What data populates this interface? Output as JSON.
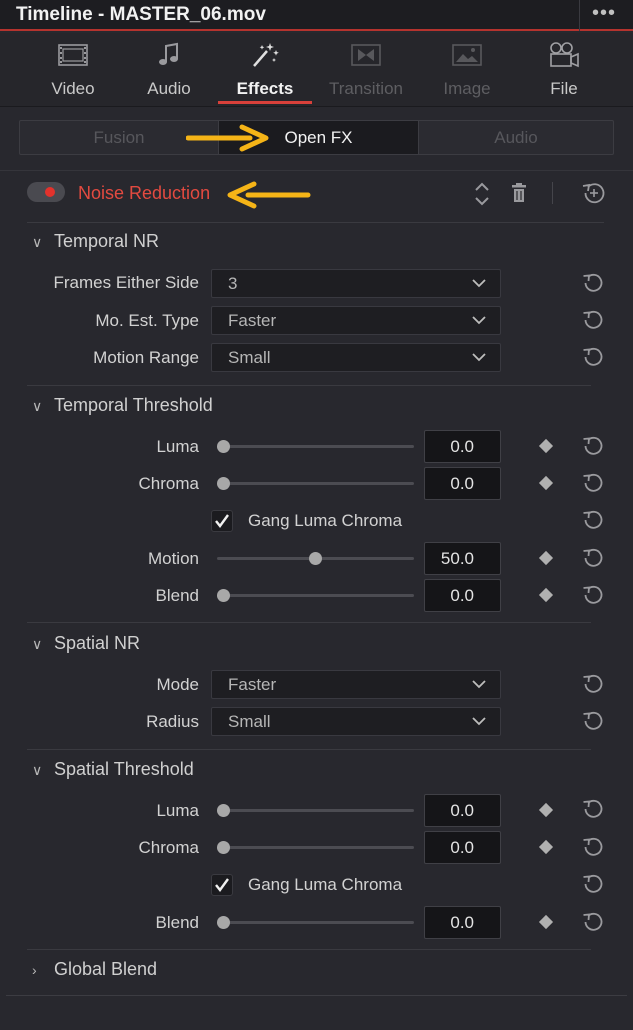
{
  "window": {
    "title": "Timeline - MASTER_06.mov",
    "more_label": "•••"
  },
  "tabs": [
    {
      "label": "Video",
      "icon": "film-strip-icon",
      "state": "normal"
    },
    {
      "label": "Audio",
      "icon": "music-note-icon",
      "state": "normal"
    },
    {
      "label": "Effects",
      "icon": "magic-wand-icon",
      "state": "active"
    },
    {
      "label": "Transition",
      "icon": "transition-icon",
      "state": "disabled"
    },
    {
      "label": "Image",
      "icon": "image-icon",
      "state": "disabled"
    },
    {
      "label": "File",
      "icon": "film-camera-icon",
      "state": "normal"
    }
  ],
  "effect_tabs": [
    {
      "label": "Fusion",
      "state": "inactive"
    },
    {
      "label": "Open FX",
      "state": "active"
    },
    {
      "label": "Audio",
      "state": "inactive"
    }
  ],
  "effect": {
    "name": "Noise Reduction",
    "enabled": true,
    "name_color": "#e34a40"
  },
  "sections": {
    "temporal_nr": {
      "title": "Temporal NR",
      "expanded": true,
      "frames_either_side": {
        "label": "Frames Either Side",
        "value": "3"
      },
      "mo_est_type": {
        "label": "Mo. Est. Type",
        "value": "Faster"
      },
      "motion_range": {
        "label": "Motion Range",
        "value": "Small"
      }
    },
    "temporal_threshold": {
      "title": "Temporal Threshold",
      "expanded": true,
      "luma": {
        "label": "Luma",
        "value": "0.0",
        "fraction": 0.0
      },
      "chroma": {
        "label": "Chroma",
        "value": "0.0",
        "fraction": 0.0
      },
      "gang": {
        "label": "Gang Luma Chroma",
        "checked": true
      },
      "motion": {
        "label": "Motion",
        "value": "50.0",
        "fraction": 0.5
      },
      "blend": {
        "label": "Blend",
        "value": "0.0",
        "fraction": 0.0
      }
    },
    "spatial_nr": {
      "title": "Spatial NR",
      "expanded": true,
      "mode": {
        "label": "Mode",
        "value": "Faster"
      },
      "radius": {
        "label": "Radius",
        "value": "Small"
      }
    },
    "spatial_threshold": {
      "title": "Spatial Threshold",
      "expanded": true,
      "luma": {
        "label": "Luma",
        "value": "0.0",
        "fraction": 0.0
      },
      "chroma": {
        "label": "Chroma",
        "value": "0.0",
        "fraction": 0.0
      },
      "gang": {
        "label": "Gang Luma Chroma",
        "checked": true
      },
      "blend": {
        "label": "Blend",
        "value": "0.0",
        "fraction": 0.0
      }
    },
    "global_blend": {
      "title": "Global Blend",
      "expanded": false
    }
  },
  "colors": {
    "accent_red": "#d8403a",
    "annotation_arrow": "#f5b417"
  }
}
